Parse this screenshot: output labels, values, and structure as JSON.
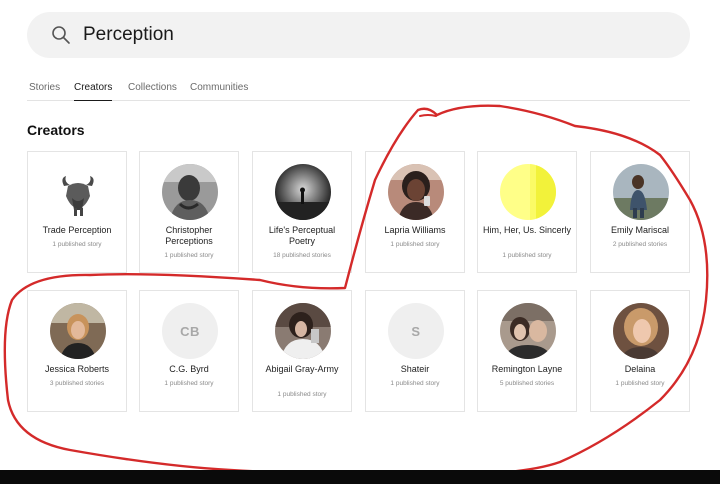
{
  "search": {
    "query": "Perception",
    "icon": "search-icon"
  },
  "tabs": [
    {
      "label": "Stories",
      "active": false
    },
    {
      "label": "Creators",
      "active": true
    },
    {
      "label": "Collections",
      "active": false
    },
    {
      "label": "Communities",
      "active": false
    }
  ],
  "section_title": "Creators",
  "creators": [
    {
      "name": "Trade Perception",
      "count": "1 published story"
    },
    {
      "name": "Christopher Perceptions",
      "count": "1 published story"
    },
    {
      "name": "Life's Perceptual Poetry",
      "count": "18 published stories"
    },
    {
      "name": "Lapria Williams",
      "count": "1 published story"
    },
    {
      "name": "Him, Her, Us. Sincerly",
      "count": "1 published story"
    },
    {
      "name": "Emily Mariscal",
      "count": "2 published stories"
    },
    {
      "name": "Jessica Roberts",
      "count": "3 published stories"
    },
    {
      "name": "C.G. Byrd",
      "count": "1 published story",
      "initials": "CB"
    },
    {
      "name": "Abigail Gray-Army",
      "count": "1 published story"
    },
    {
      "name": "Shateir",
      "count": "1 published story",
      "initials": "S"
    },
    {
      "name": "Remington Layne",
      "count": "5 published stories"
    },
    {
      "name": "Delaina",
      "count": "1 published story"
    }
  ],
  "colors": {
    "annotation": "#d42a2a",
    "search_bg": "#f2f2f2",
    "card_border": "#e4e4e4"
  }
}
